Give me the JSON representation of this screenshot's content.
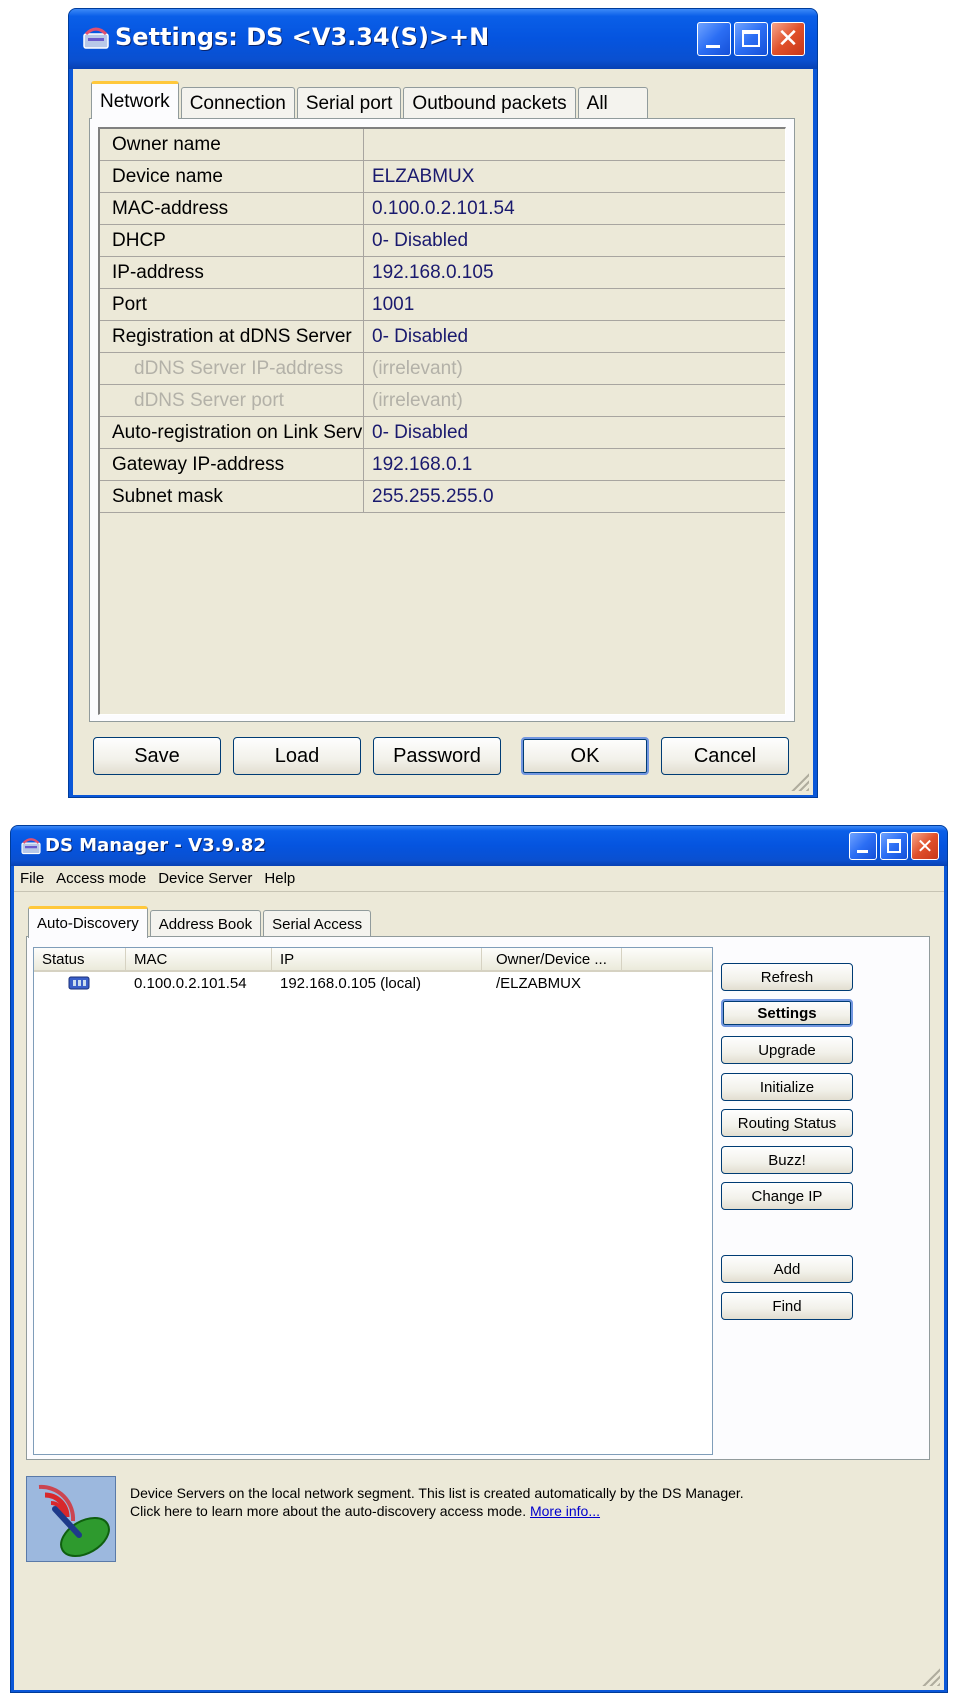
{
  "settings": {
    "title": "Settings: DS <V3.34(S)>+N",
    "tabs": [
      {
        "label": "Network",
        "active": true
      },
      {
        "label": "Connection"
      },
      {
        "label": "Serial port"
      },
      {
        "label": "Outbound packets"
      },
      {
        "label": "All"
      }
    ],
    "rows": [
      {
        "name": "Owner name",
        "value": ""
      },
      {
        "name": "Device name",
        "value": "ELZABMUX"
      },
      {
        "name": "MAC-address",
        "value": "0.100.0.2.101.54"
      },
      {
        "name": "DHCP",
        "value": "0- Disabled"
      },
      {
        "name": "IP-address",
        "value": "192.168.0.105"
      },
      {
        "name": "Port",
        "value": "1001"
      },
      {
        "name": "Registration at dDNS Server",
        "value": "0- Disabled"
      },
      {
        "name": "dDNS Server IP-address",
        "value": "(irrelevant)",
        "dim": true
      },
      {
        "name": "dDNS Server port",
        "value": "(irrelevant)",
        "dim": true
      },
      {
        "name": "Auto-registration on Link Serv",
        "value": "0- Disabled"
      },
      {
        "name": "Gateway IP-address",
        "value": "192.168.0.1"
      },
      {
        "name": "Subnet mask",
        "value": "255.255.255.0"
      }
    ],
    "buttons": {
      "save": "Save",
      "load": "Load",
      "password": "Password",
      "ok": "OK",
      "cancel": "Cancel"
    }
  },
  "dsm": {
    "title": "DS Manager - V3.9.82",
    "menu": [
      "File",
      "Access mode",
      "Device Server",
      "Help"
    ],
    "tabs": [
      {
        "label": "Auto-Discovery",
        "active": true
      },
      {
        "label": "Address Book"
      },
      {
        "label": "Serial Access"
      }
    ],
    "columns": {
      "status": "Status",
      "mac": "MAC",
      "ip": "IP",
      "owner": "Owner/Device ..."
    },
    "rows": [
      {
        "status_icon": "device-server-icon",
        "mac": "0.100.0.2.101.54",
        "ip": "192.168.0.105 (local)",
        "owner": "/ELZABMUX"
      }
    ],
    "buttons": {
      "refresh": "Refresh",
      "settings": "Settings",
      "upgrade": "Upgrade",
      "initialize": "Initialize",
      "routing": "Routing Status",
      "buzz": "Buzz!",
      "change_ip": "Change IP",
      "add": "Add",
      "find": "Find"
    },
    "info": {
      "line1": "Device Servers on the local network segment. This list is created automatically by the DS Manager.",
      "line2": "Click here to learn more about the auto-discovery access mode.",
      "link": "More info..."
    }
  }
}
